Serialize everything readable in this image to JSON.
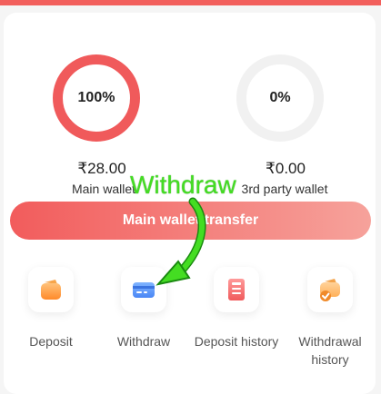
{
  "wallets": {
    "main": {
      "percent": "100%",
      "amount": "₹28.00",
      "label": "Main wallet"
    },
    "third": {
      "percent": "0%",
      "amount": "₹0.00",
      "label": "3rd party wallet"
    }
  },
  "transfer_button": "Main wallet transfer",
  "annotation": {
    "text": "Withdraw",
    "color": "#44dd22"
  },
  "actions": [
    {
      "label": "Deposit",
      "icon": "wallet-icon"
    },
    {
      "label": "Withdraw",
      "icon": "card-icon"
    },
    {
      "label": "Deposit history",
      "icon": "receipt-icon"
    },
    {
      "label": "Withdrawal history",
      "icon": "wallet-check-icon"
    }
  ],
  "colors": {
    "accent": "#f05a5b",
    "ring_empty": "#f1f1f1"
  }
}
